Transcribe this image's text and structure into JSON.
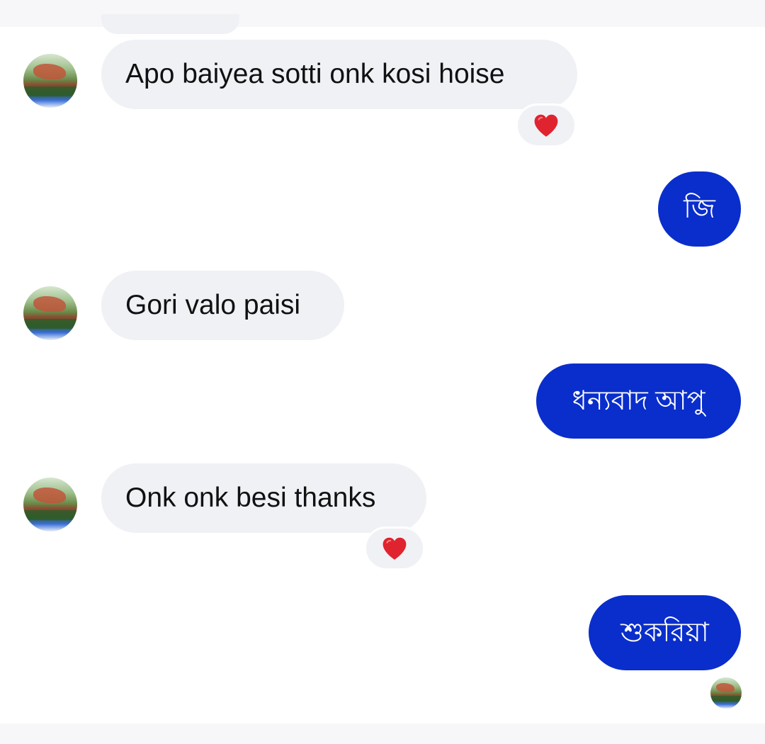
{
  "messages": [
    {
      "direction": "in",
      "text": "Apo baiyea sotti onk kosi hoise",
      "reaction": "heart"
    },
    {
      "direction": "out",
      "text": "জি"
    },
    {
      "direction": "in",
      "text": "Gori valo paisi"
    },
    {
      "direction": "out",
      "text": "ধন্যবাদ আপু"
    },
    {
      "direction": "in",
      "text": "Onk onk besi thanks",
      "reaction": "heart"
    },
    {
      "direction": "out",
      "text": "শুকরিয়া"
    }
  ],
  "icons": {
    "reaction": "heart-icon",
    "avatar": "contact-avatar",
    "read_receipt": "seen-avatar"
  },
  "colors": {
    "incoming_bubble": "#f0f1f5",
    "outgoing_bubble": "#0a2ecb",
    "heart": "#e0242f"
  }
}
